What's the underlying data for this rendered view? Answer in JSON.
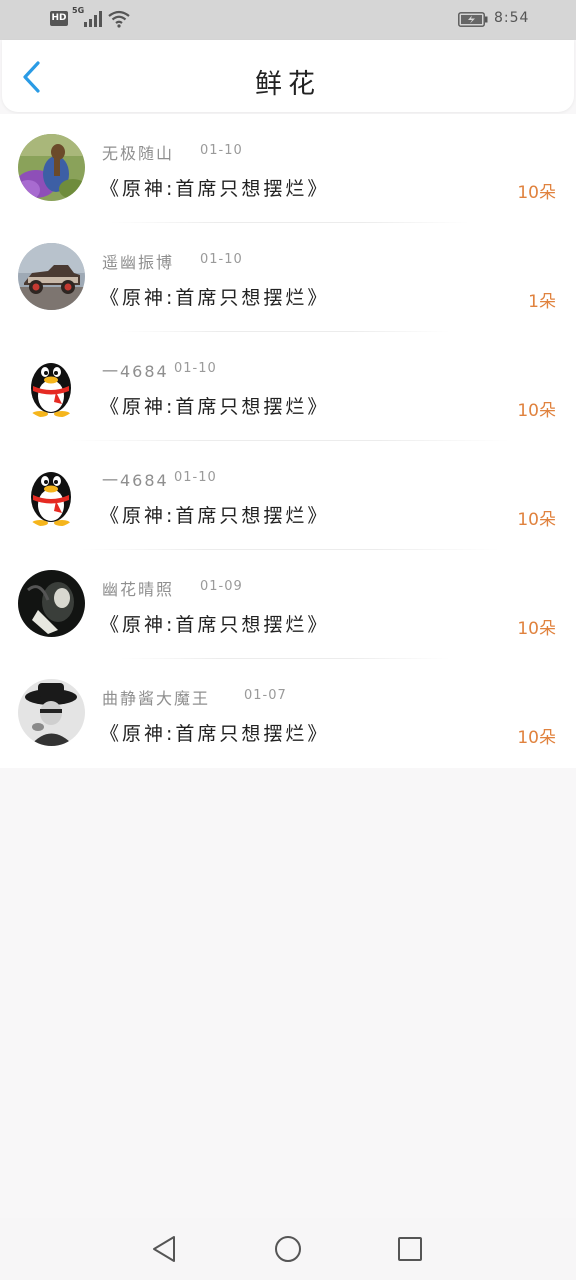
{
  "status_bar": {
    "hd": "HD",
    "network": "5G",
    "time": "8:54"
  },
  "header": {
    "title": "鲜花",
    "back_icon": "chevron-left-icon",
    "accent_color": "#2a9be5"
  },
  "list": {
    "book_color": "#222222",
    "count_color": "#e0823e",
    "items": [
      {
        "name": "无极随山",
        "date": "01-10",
        "book": "《原神:首席只想摆烂》",
        "count": "10朵",
        "avatar": "girl-with-flowers"
      },
      {
        "name": "遥幽振博",
        "date": "01-10",
        "book": "《原神:首席只想摆烂》",
        "count": "1朵",
        "avatar": "vintage-car"
      },
      {
        "name": "一4684",
        "date": "01-10",
        "book": "《原神:首席只想摆烂》",
        "count": "10朵",
        "avatar": "qq-penguin"
      },
      {
        "name": "一4684",
        "date": "01-10",
        "book": "《原神:首席只想摆烂》",
        "count": "10朵",
        "avatar": "qq-penguin"
      },
      {
        "name": "幽花晴照",
        "date": "01-09",
        "book": "《原神:首席只想摆烂》",
        "count": "10朵",
        "avatar": "dark-portrait"
      },
      {
        "name": "曲静酱大魔王",
        "date": "01-07",
        "book": "《原神:首席只想摆烂》",
        "count": "10朵",
        "avatar": "hat-portrait"
      }
    ]
  },
  "nav_bar": {
    "back": "triangle-back-icon",
    "home": "circle-home-icon",
    "recents": "square-recents-icon"
  }
}
